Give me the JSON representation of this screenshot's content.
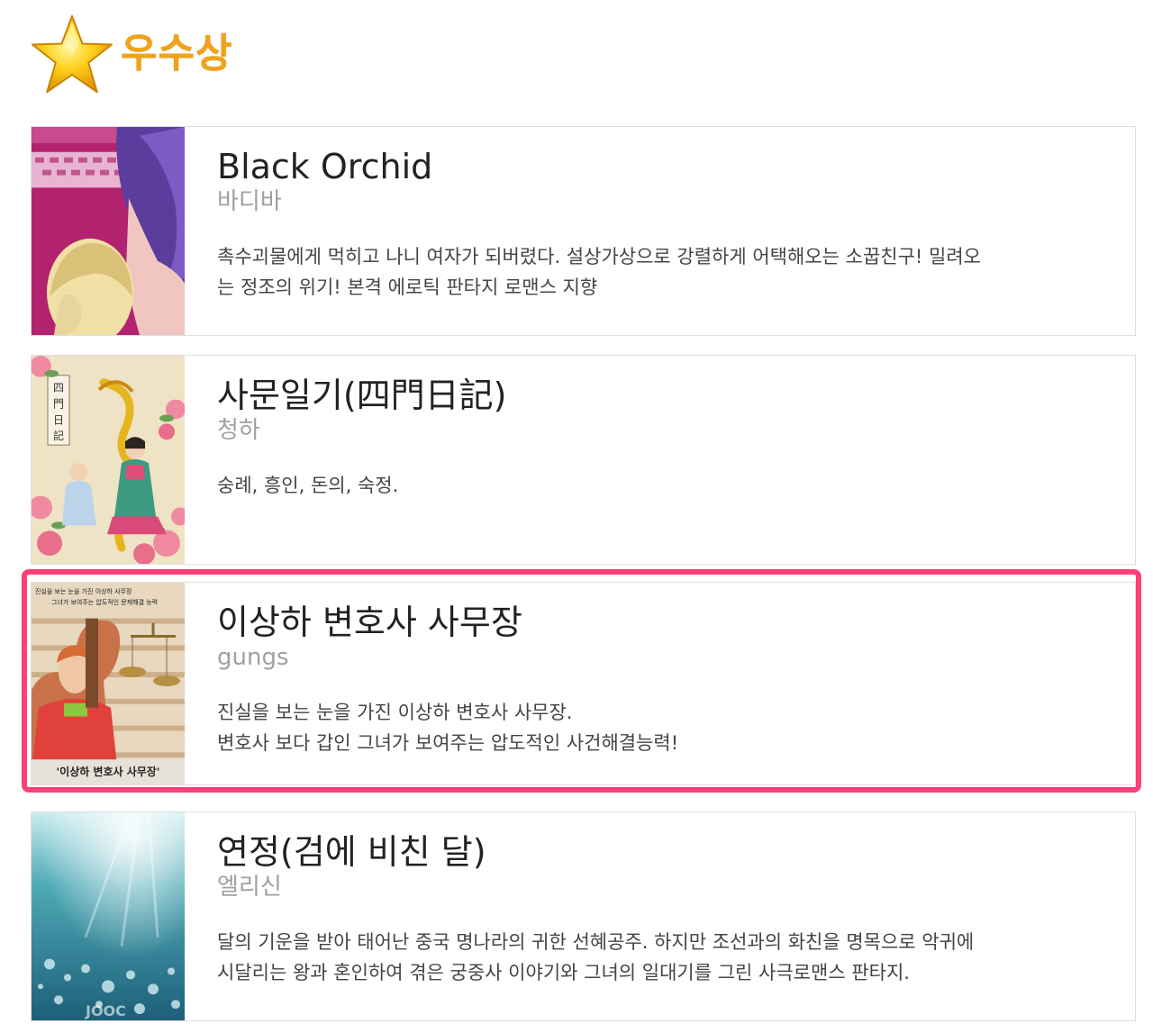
{
  "header": {
    "title": "우수상",
    "icon": "star-icon",
    "title_color": "#f0a21a"
  },
  "highlight_color": "#ff3f77",
  "works": [
    {
      "title": "Black Orchid",
      "author": "바디바",
      "description": "촉수괴물에게 먹히고 나니 여자가 되버렸다. 설상가상으로 강렬하게 어택해오는 소꿉친구! 밀려오\n는 정조의 위기! 본격 에로틱 판타지 로맨스 지향",
      "thumbnail": "black-orchid-cover"
    },
    {
      "title": "사문일기(四門日記)",
      "author": "청하",
      "description": "숭례, 흥인, 돈의, 숙정.",
      "thumbnail": "samun-ilgi-cover",
      "cover_text": "四門日記"
    },
    {
      "title": "이상하 변호사 사무장",
      "author": "gungs",
      "description": "진실을 보는 눈을 가진 이상하 변호사 사무장.\n변호사 보다 갑인 그녀가 보여주는 압도적인 사건해결능력!",
      "thumbnail": "lawyer-office-cover",
      "cover_text_top": "진실을 보는 눈을 가진 이상하 사무장",
      "cover_text_top2": "그녀가 보여주는 압도적인 문제해결 능력",
      "cover_text_bottom": "'이상하 변호사 사무장'",
      "highlighted": true
    },
    {
      "title": "연정(검에 비친 달)",
      "author": "엘리신",
      "description": "달의 기운을 받아 태어난 중국 명나라의 귀한 선혜공주. 하지만 조선과의 화친을 명목으로 악귀에\n시달리는 왕과 혼인하여 겪은 궁중사 이야기와 그녀의 일대기를 그린 사극로맨스 판타지.",
      "thumbnail": "yeonjeong-cover",
      "cover_text": "JOOC"
    }
  ]
}
